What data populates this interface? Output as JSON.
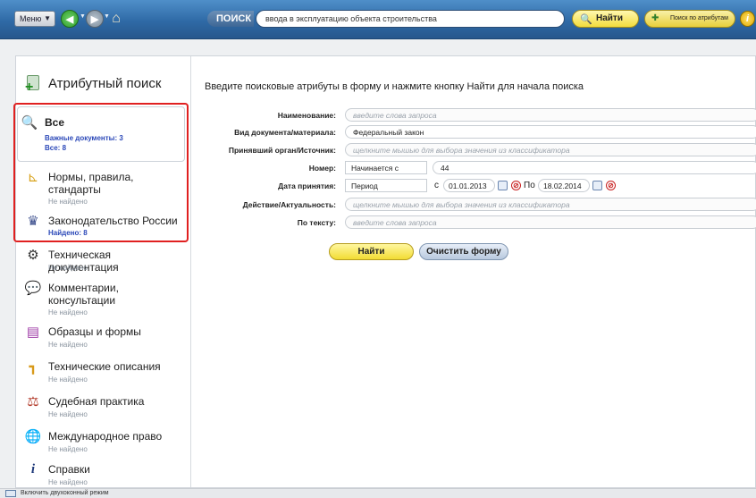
{
  "toolbar": {
    "menu_label": "Меню",
    "search_label": "ПОИСК",
    "search_value": "ввода в эксплуатацию объекта строительства",
    "find_label": "Найти",
    "attr_search_label": "Поиск по атрибутам",
    "info_label": "i"
  },
  "sidebar": {
    "title": "Атрибутный поиск",
    "categories": [
      {
        "label": "Все",
        "sub1": "Важные документы: 3",
        "sub2": "Все: 8",
        "icon": "search-icon"
      },
      {
        "label": "Нормы, правила, стандарты",
        "sub": "Не найдено",
        "icon": "ruler-icon"
      },
      {
        "label": "Законодательство России",
        "sub": "Найдено: 8",
        "icon": "emblem-icon"
      },
      {
        "label": "Техническая документация",
        "sub": "Не найдено",
        "icon": "gears-icon"
      },
      {
        "label": "Комментарии, консультации",
        "sub": "Не найдено",
        "icon": "chat-icon"
      },
      {
        "label": "Образцы и формы",
        "sub": "Не найдено",
        "icon": "form-icon"
      },
      {
        "label": "Технические описания",
        "sub": "Не найдено",
        "icon": "tech-icon"
      },
      {
        "label": "Судебная практика",
        "sub": "Не найдено",
        "icon": "scales-icon"
      },
      {
        "label": "Международное право",
        "sub": "Не найдено",
        "icon": "globe-icon"
      },
      {
        "label": "Справки",
        "sub": "Не найдено",
        "icon": "info-icon"
      }
    ]
  },
  "content": {
    "intro": "Введите поисковые атрибуты в форму и нажмите кнопку Найти для начала поиска",
    "fields": [
      {
        "label": "Наименование:",
        "value": "введите слова запроса"
      },
      {
        "label": "Вид документа/материала:",
        "value": "Федеральный закон"
      },
      {
        "label": "Принявший орган/Источник:",
        "value": "щелкните мышью для выбора значения из классификатора"
      },
      {
        "label": "Номер:",
        "mode": "Начинается с",
        "value": "44"
      },
      {
        "label": "Дата принятия:",
        "mode": "Период",
        "from_label": "с",
        "from": "01.01.2013",
        "to_label": "По",
        "to": "18.02.2014"
      },
      {
        "label": "Действие/Актуальность:",
        "value": "щелкните мышью для выбора значения из классификатора"
      },
      {
        "label": "По тексту:",
        "value": "введите слова запроса"
      }
    ],
    "find_button": "Найти",
    "clear_button": "Очистить форму"
  },
  "status": {
    "text": "Включить двухоконный режим"
  }
}
